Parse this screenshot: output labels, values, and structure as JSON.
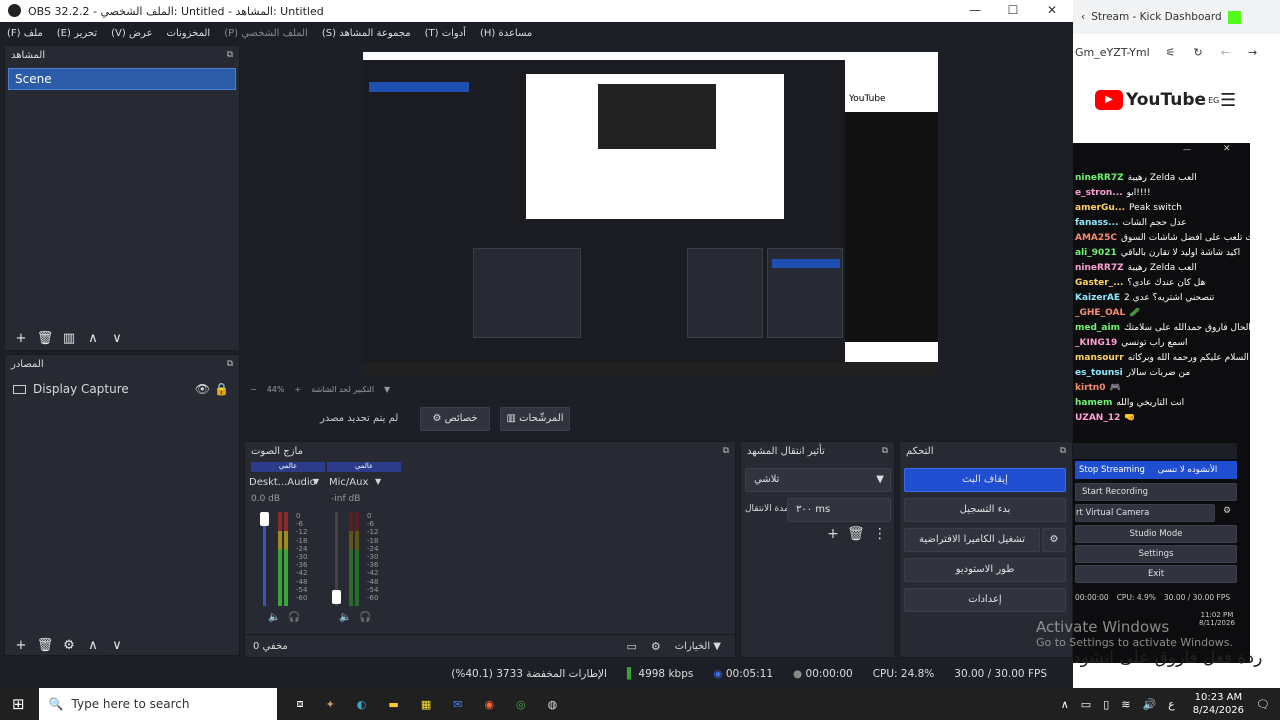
{
  "window": {
    "title": "OBS 32.2.2 - الملف الشخصي: Untitled - المشاهد: Untitled",
    "minimize": "—",
    "maximize": "☐",
    "close": "✕"
  },
  "menu": [
    "(F) ملف",
    "(E) تحرير",
    "(V) عرض",
    "المخزونات",
    "(P) الملف الشخصي",
    "(S) مجموعة المشاهد",
    "(T) أدوات",
    "(H) مساعدة"
  ],
  "scenes": {
    "title": "المشاهد",
    "items": [
      "Scene"
    ]
  },
  "sources": {
    "title": "المصادر",
    "items": [
      "Display Capture"
    ]
  },
  "toolbar": {
    "no_source": "لم يتم تحديد مصدر",
    "properties": "خصائص",
    "filters": "المرشّحات"
  },
  "mixer": {
    "title": "مازج الصوت",
    "channels": [
      {
        "name": "Deskt...Audio",
        "db": "0.0 dB",
        "tag": "عالمي"
      },
      {
        "name": "Mic/Aux",
        "db": "-inf dB",
        "tag": "عالمي"
      }
    ],
    "scale": [
      "0",
      "-6",
      "-12",
      "-18",
      "-24",
      "-30",
      "-36",
      "-42",
      "-48",
      "-54",
      "-60"
    ],
    "footer": "0 مخفي",
    "options": "الخيارات"
  },
  "transitions": {
    "title": "تأثير انتقال المشهد",
    "type": "تلاشي",
    "duration_label": "مدة الانتقال",
    "duration": "٣٠٠ ms"
  },
  "controls": {
    "title": "التحكم",
    "stop_stream": "إيقاف البث",
    "start_recording": "بدء التسجيل",
    "virtual_camera": "تشغيل الكاميرا الافتراضية",
    "studio_mode": "طور الاستوديو",
    "settings": "إعدادات"
  },
  "zoom": {
    "value": "44%",
    "label": "التكبير لحد الشاشة"
  },
  "status": {
    "dropped": "الإطارات المخفضة 3733 (40.1%)",
    "bitrate": "4998 kbps",
    "stream_time": "00:05:11",
    "rec_time": "00:00:00",
    "cpu": "CPU: 24.8%",
    "fps": "30.00 / 30.00 FPS"
  },
  "browser": {
    "tab": "Stream - Kick Dashboard",
    "url": "Gm_eYZT-Yml",
    "youtube": "YouTube",
    "region": "EG",
    "overlay_title": "ردة فعل فاروق على انشود"
  },
  "chat": [
    {
      "user": "nineRR7Z",
      "msg": "رهيبة Zelda العب"
    },
    {
      "user": "e_stron...",
      "msg": "ابو!!!!"
    },
    {
      "user": "amerGu...",
      "msg": "Peak switch"
    },
    {
      "user": "fanass...",
      "msg": "عدل حجم الشات"
    },
    {
      "user": "AMA25C",
      "msg": "طيبا انت تلعب على أفضل شاشات السوق"
    },
    {
      "user": "ali_9021",
      "msg": "أكيد شاشة اوليد لا تقارن بالباقي"
    },
    {
      "user": "nineRR7Z",
      "msg": "رهيبة Zelda العب"
    },
    {
      "user": "Gaster_...",
      "msg": "هل كان عندك عادي؟"
    },
    {
      "user": "KaizerAE",
      "msg": "تنصحني اشتريه؟ عدي 2"
    },
    {
      "user": "_GHE_OAL",
      "msg": "🥒"
    },
    {
      "user": "med_aim",
      "msg": "كيف الحال فاروق حمدالله على سلامتك"
    },
    {
      "user": "_KING19",
      "msg": "اسمع راب تونسي"
    },
    {
      "user": "mansourr",
      "msg": "السلام عليكم ورحمه الله وبركاته"
    },
    {
      "user": "es_tounsi",
      "msg": "من ضربات سالار"
    },
    {
      "user": "kirtn0",
      "msg": "🎮"
    },
    {
      "user": "hamem",
      "msg": "انت التاريخي والله"
    },
    {
      "user": "UZAN_12",
      "msg": "🤜"
    }
  ],
  "mini_obs": {
    "start_recording": "Start Recording",
    "virtual_camera": "rt Virtual Camera",
    "studio_mode": "Studio Mode",
    "settings": "Settings",
    "exit": "Exit",
    "stop_streaming": "Stop Streaming",
    "cpu": "CPU: 4.9%",
    "fps": "30.00 / 30.00 FPS",
    "time": "00:00:00",
    "clock": "11:02 PM",
    "date": "8/11/2026",
    "overlay": "الأنشوده لا تنسى"
  },
  "activate": {
    "line1": "Activate Windows",
    "line2": "Go to Settings to activate Windows."
  },
  "taskbar": {
    "search": "Type here to search",
    "time": "10:23 AM",
    "date": "8/24/2026"
  }
}
